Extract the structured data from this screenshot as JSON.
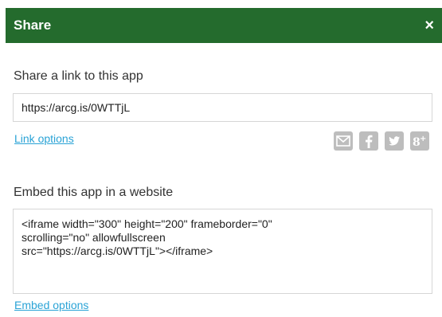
{
  "dialog": {
    "title": "Share",
    "close_label": "×"
  },
  "share_link": {
    "heading": "Share a link to this app",
    "url": "https://arcg.is/0WTTjL",
    "options_label": "Link options"
  },
  "social_icons": [
    "email-icon",
    "facebook-icon",
    "twitter-icon",
    "google-plus-icon"
  ],
  "embed": {
    "heading": "Embed this app in a website",
    "code": "<iframe width=\"300\" height=\"200\" frameborder=\"0\"\nscrolling=\"no\" allowfullscreen\nsrc=\"https://arcg.is/0WTTjL\"></iframe>",
    "options_label": "Embed options"
  },
  "colors": {
    "header_bg": "#246b2d",
    "link": "#2aa3d6",
    "icon_gray": "#bdbdbd"
  }
}
